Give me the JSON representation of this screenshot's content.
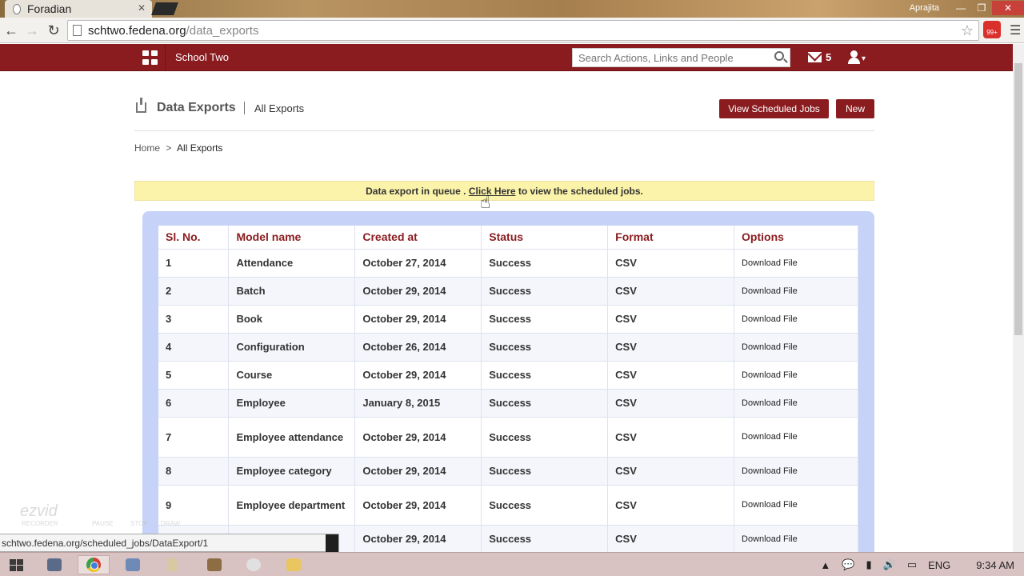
{
  "browser": {
    "tab_title": "Foradian",
    "url_host": "schtwo.fedena.org",
    "url_path": "/data_exports",
    "window_user": "Aprajita",
    "extension_badge": "99+"
  },
  "header": {
    "school_name": "School Two",
    "search_placeholder": "Search Actions, Links and People",
    "mail_count": "5"
  },
  "page": {
    "title": "Data Exports",
    "subtitle": "All Exports",
    "btn_scheduled": "View Scheduled Jobs",
    "btn_new": "New",
    "breadcrumb_home": "Home",
    "breadcrumb_sep": ">",
    "breadcrumb_current": "All Exports",
    "notice_prefix": "Data export in queue . ",
    "notice_link": "Click Here",
    "notice_suffix": " to view the scheduled jobs."
  },
  "table": {
    "headers": [
      "Sl. No.",
      "Model name",
      "Created at",
      "Status",
      "Format",
      "Options"
    ],
    "rows": [
      [
        "1",
        "Attendance",
        "October 27, 2014",
        "Success",
        "CSV",
        "Download File"
      ],
      [
        "2",
        "Batch",
        "October 29, 2014",
        "Success",
        "CSV",
        "Download File"
      ],
      [
        "3",
        "Book",
        "October 29, 2014",
        "Success",
        "CSV",
        "Download File"
      ],
      [
        "4",
        "Configuration",
        "October 26, 2014",
        "Success",
        "CSV",
        "Download File"
      ],
      [
        "5",
        "Course",
        "October 29, 2014",
        "Success",
        "CSV",
        "Download File"
      ],
      [
        "6",
        "Employee",
        "January 8, 2015",
        "Success",
        "CSV",
        "Download File"
      ],
      [
        "7",
        "Employee attendance",
        "October 29, 2014",
        "Success",
        "CSV",
        "Download File"
      ],
      [
        "8",
        "Employee category",
        "October 29, 2014",
        "Success",
        "CSV",
        "Download File"
      ],
      [
        "9",
        "Employee department",
        "October 29, 2014",
        "Success",
        "CSV",
        "Download File"
      ],
      [
        "",
        "",
        "October 29, 2014",
        "Success",
        "CSV",
        "Download File"
      ]
    ]
  },
  "status_url": "schtwo.fedena.org/scheduled_jobs/DataExport/1",
  "recorder": {
    "logo": "ezvid",
    "sub": "RECORDER",
    "pause": "PAUSE",
    "stop": "STOP",
    "draw": "DRAW"
  },
  "taskbar": {
    "lang": "ENG",
    "time": "9:34 AM"
  },
  "colors": {
    "brand": "#8a1c1f",
    "notice_bg": "#fbf3a9",
    "panel_bg": "#c6d2f7"
  }
}
